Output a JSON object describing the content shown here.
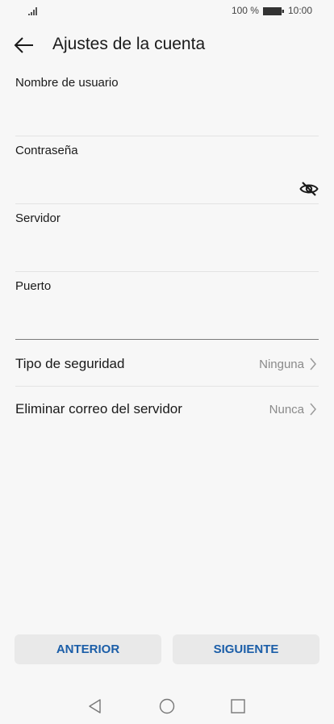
{
  "status_bar": {
    "battery_text": "100 %",
    "time": "10:00"
  },
  "header": {
    "title": "Ajustes de la cuenta"
  },
  "fields": {
    "username_label": "Nombre de usuario",
    "password_label": "Contraseña",
    "server_label": "Servidor",
    "port_label": "Puerto"
  },
  "settings": {
    "security_label": "Tipo de seguridad",
    "security_value": "Ninguna",
    "delete_label": "Eliminar correo del servidor",
    "delete_value": "Nunca"
  },
  "buttons": {
    "previous": "ANTERIOR",
    "next": "SIGUIENTE"
  },
  "colors": {
    "accent": "#1b5ea8",
    "background": "#f7f7f7"
  },
  "icons": [
    "signal-icon",
    "battery-icon",
    "back-arrow-icon",
    "eye-off-icon",
    "chevron-right-icon",
    "nav-back-icon",
    "nav-home-icon",
    "nav-recents-icon"
  ]
}
